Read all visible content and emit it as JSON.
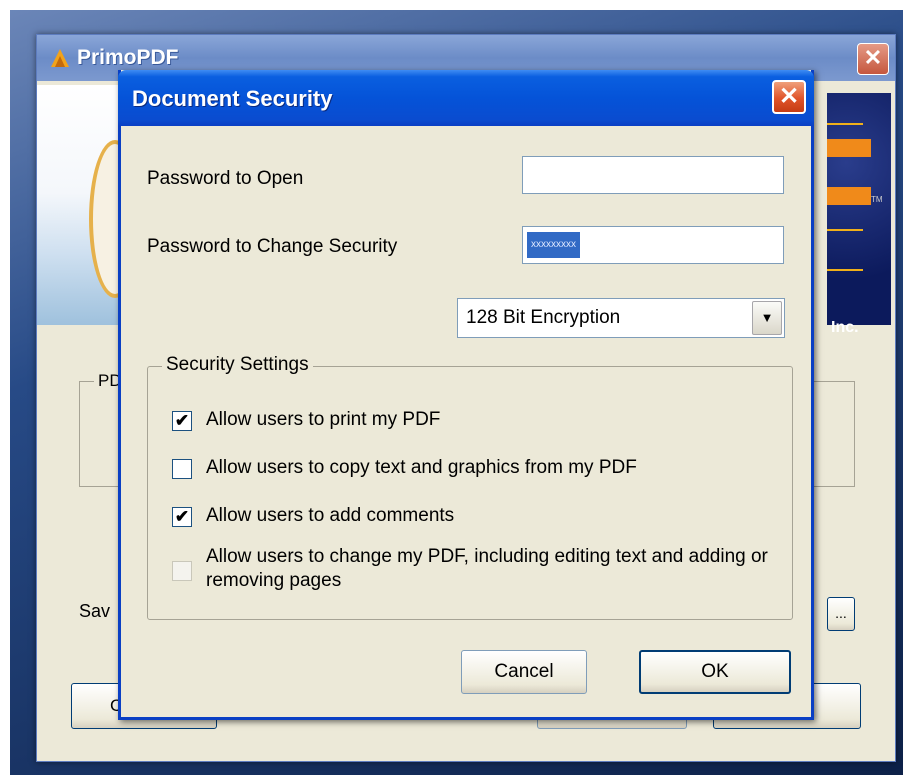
{
  "primo_window": {
    "title": "PrimoPDF",
    "brand_suffix": "Inc.",
    "trademark": "TM",
    "pdf_group_label": "PD",
    "save_label": "Sav",
    "browse_label": "...",
    "bottom_button_1": "C"
  },
  "dialog": {
    "title": "Document Security",
    "close_icon": "close-icon",
    "password_open_label": "Password to Open",
    "password_open_value": "",
    "password_change_label": "Password to Change Security",
    "password_change_value": "xxxxxxxxx",
    "encryption_selected": "128 Bit Encryption",
    "security_settings_label": "Security Settings",
    "options": [
      {
        "label": "Allow users to print my PDF",
        "checked": true,
        "enabled": true
      },
      {
        "label": "Allow users to copy text and graphics from my PDF",
        "checked": false,
        "enabled": true
      },
      {
        "label": "Allow users to add comments",
        "checked": true,
        "enabled": true
      },
      {
        "label": "Allow users to change my PDF, including editing text and adding or removing pages",
        "checked": false,
        "enabled": false
      }
    ],
    "cancel_label": "Cancel",
    "ok_label": "OK"
  },
  "colors": {
    "title_bar": "#0553d8",
    "dialog_face": "#ece9d8",
    "close_button": "#e0542a",
    "selection": "#316ac5"
  }
}
